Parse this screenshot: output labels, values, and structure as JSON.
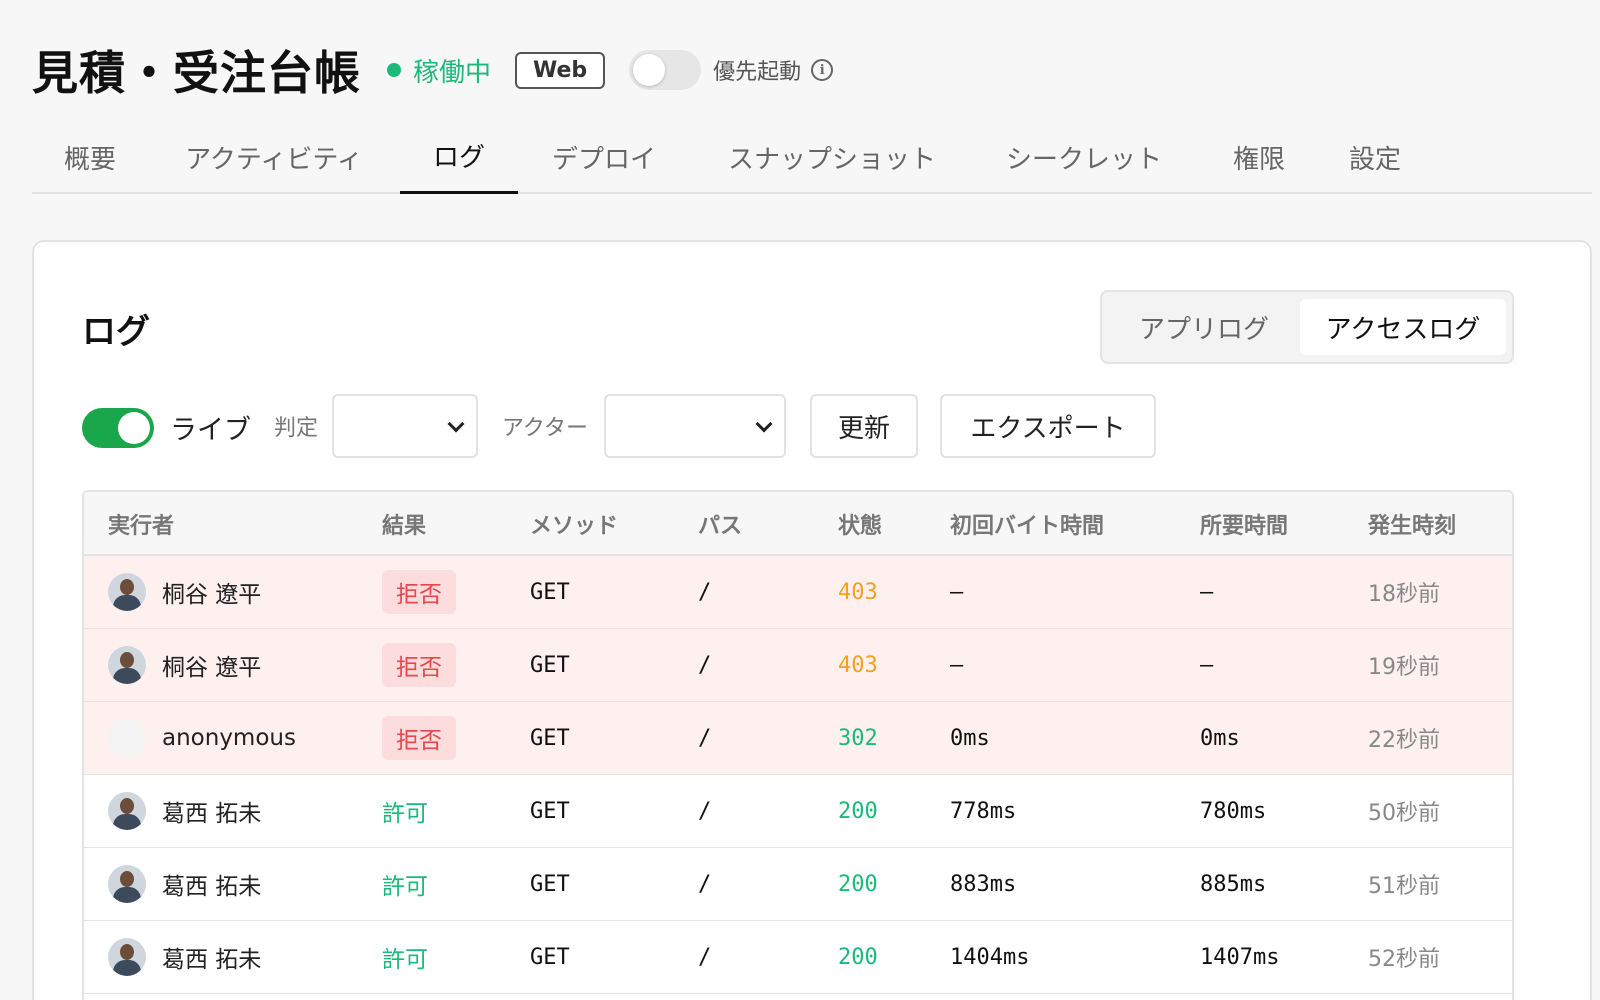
{
  "header": {
    "title": "見積・受注台帳",
    "status": "稼働中",
    "web_badge": "Web",
    "priority_label": "優先起動",
    "priority_enabled": false
  },
  "tabs": [
    {
      "label": "概要",
      "active": false
    },
    {
      "label": "アクティビティ",
      "active": false
    },
    {
      "label": "ログ",
      "active": true
    },
    {
      "label": "デプロイ",
      "active": false
    },
    {
      "label": "スナップショット",
      "active": false
    },
    {
      "label": "シークレット",
      "active": false
    },
    {
      "label": "権限",
      "active": false
    },
    {
      "label": "設定",
      "active": false
    }
  ],
  "panel": {
    "title": "ログ",
    "log_types": {
      "app": "アプリログ",
      "access": "アクセスログ",
      "selected": "access"
    }
  },
  "controls": {
    "live_label": "ライブ",
    "live_enabled": true,
    "verdict_label": "判定",
    "verdict_value": "",
    "actor_label": "アクター",
    "actor_value": "",
    "refresh_label": "更新",
    "export_label": "エクスポート"
  },
  "table": {
    "columns": [
      "実行者",
      "結果",
      "メソッド",
      "パス",
      "状態",
      "初回バイト時間",
      "所要時間",
      "発生時刻"
    ],
    "rows": [
      {
        "actor": "桐谷 遼平",
        "result": "拒否",
        "method": "GET",
        "path": "/",
        "status": "403",
        "ttfb": "–",
        "duration": "–",
        "when": "18秒前"
      },
      {
        "actor": "桐谷 遼平",
        "result": "拒否",
        "method": "GET",
        "path": "/",
        "status": "403",
        "ttfb": "–",
        "duration": "–",
        "when": "19秒前"
      },
      {
        "actor": "anonymous",
        "result": "拒否",
        "method": "GET",
        "path": "/",
        "status": "302",
        "ttfb": "0ms",
        "duration": "0ms",
        "when": "22秒前"
      },
      {
        "actor": "葛西 拓未",
        "result": "許可",
        "method": "GET",
        "path": "/",
        "status": "200",
        "ttfb": "778ms",
        "duration": "780ms",
        "when": "50秒前"
      },
      {
        "actor": "葛西 拓未",
        "result": "許可",
        "method": "GET",
        "path": "/",
        "status": "200",
        "ttfb": "883ms",
        "duration": "885ms",
        "when": "51秒前"
      },
      {
        "actor": "葛西 拓未",
        "result": "許可",
        "method": "GET",
        "path": "/",
        "status": "200",
        "ttfb": "1404ms",
        "duration": "1407ms",
        "when": "52秒前"
      }
    ]
  },
  "colors": {
    "accent_green": "#1db97a",
    "live_toggle": "#1aa64a",
    "denied_bg": "#fff0f0",
    "denied_badge_bg": "#fcdcdc",
    "denied_text": "#e5484d",
    "status_403": "#f5a020"
  }
}
